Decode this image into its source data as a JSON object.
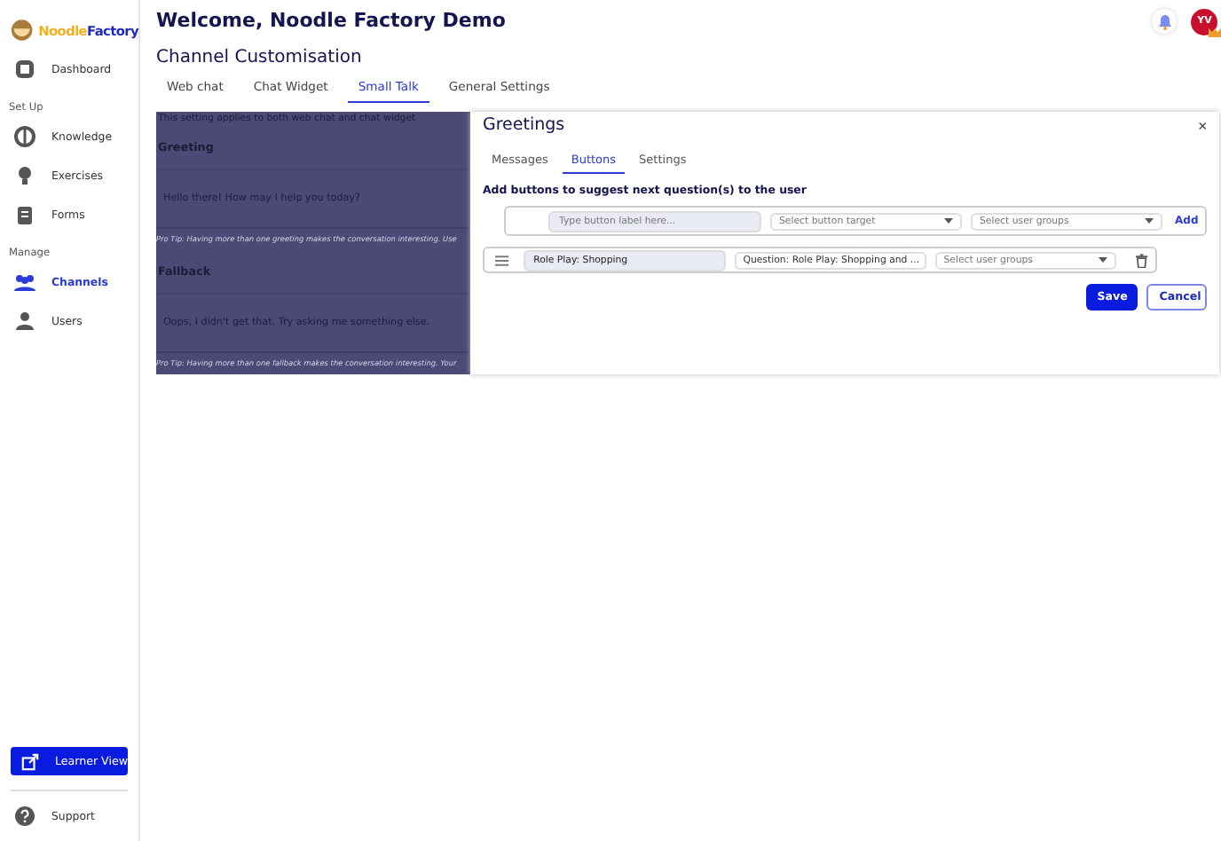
{
  "brand": {
    "name_part_1": "Noodle",
    "name_part_2": "Factory"
  },
  "sidebar": {
    "items": [
      {
        "kind": "item",
        "label": "Dashboard",
        "selected": false
      },
      {
        "kind": "section",
        "label": "Set Up"
      },
      {
        "kind": "item",
        "label": "Knowledge",
        "selected": false
      },
      {
        "kind": "item",
        "label": "Exercises",
        "selected": false
      },
      {
        "kind": "item",
        "label": "Forms",
        "selected": false
      },
      {
        "kind": "section",
        "label": "Manage"
      },
      {
        "kind": "item",
        "label": "Channels",
        "selected": true
      },
      {
        "kind": "item",
        "label": "Users",
        "selected": false
      }
    ],
    "learner_button": "Learner View",
    "support": "Support"
  },
  "header": {
    "title": "Welcome, Noodle Factory Demo",
    "avatar": "YV"
  },
  "page": {
    "title": "Channel Customisation",
    "tabs": [
      {
        "label": "Web chat",
        "selected": false
      },
      {
        "label": "Chat Widget",
        "selected": false
      },
      {
        "label": "Small Talk",
        "selected": true
      },
      {
        "label": "General Settings",
        "selected": false
      }
    ]
  },
  "small_talk": {
    "note": "This setting applies to both web chat and chat widget",
    "sections": [
      {
        "heading": "Greeting",
        "message": "Hello there! How may I help you today?",
        "tip": "Pro Tip: Having more than one greeting makes the conversation interesting. Use"
      },
      {
        "heading": "Fallback",
        "message": "Oops, I didn't get that. Try asking me something else.",
        "tip": "Pro Tip: Having more than one fallback makes the conversation interesting. Your"
      }
    ]
  },
  "dialog": {
    "title": "Greetings",
    "close": "×",
    "tabs": [
      {
        "label": "Messages",
        "selected": false
      },
      {
        "label": "Buttons",
        "selected": true
      },
      {
        "label": "Settings",
        "selected": false
      }
    ],
    "instruction": "Add buttons to suggest next question(s) to the user",
    "new_row": {
      "label_placeholder": "Type button label here...",
      "target_placeholder": "Select button target",
      "groups_placeholder": "Select user groups",
      "add": "Add"
    },
    "rows": [
      {
        "label": "Role Play: Shopping",
        "target": "Question: Role Play: Shopping and ...",
        "groups_placeholder": "Select user groups"
      }
    ],
    "save": "Save",
    "cancel": "Cancel"
  }
}
